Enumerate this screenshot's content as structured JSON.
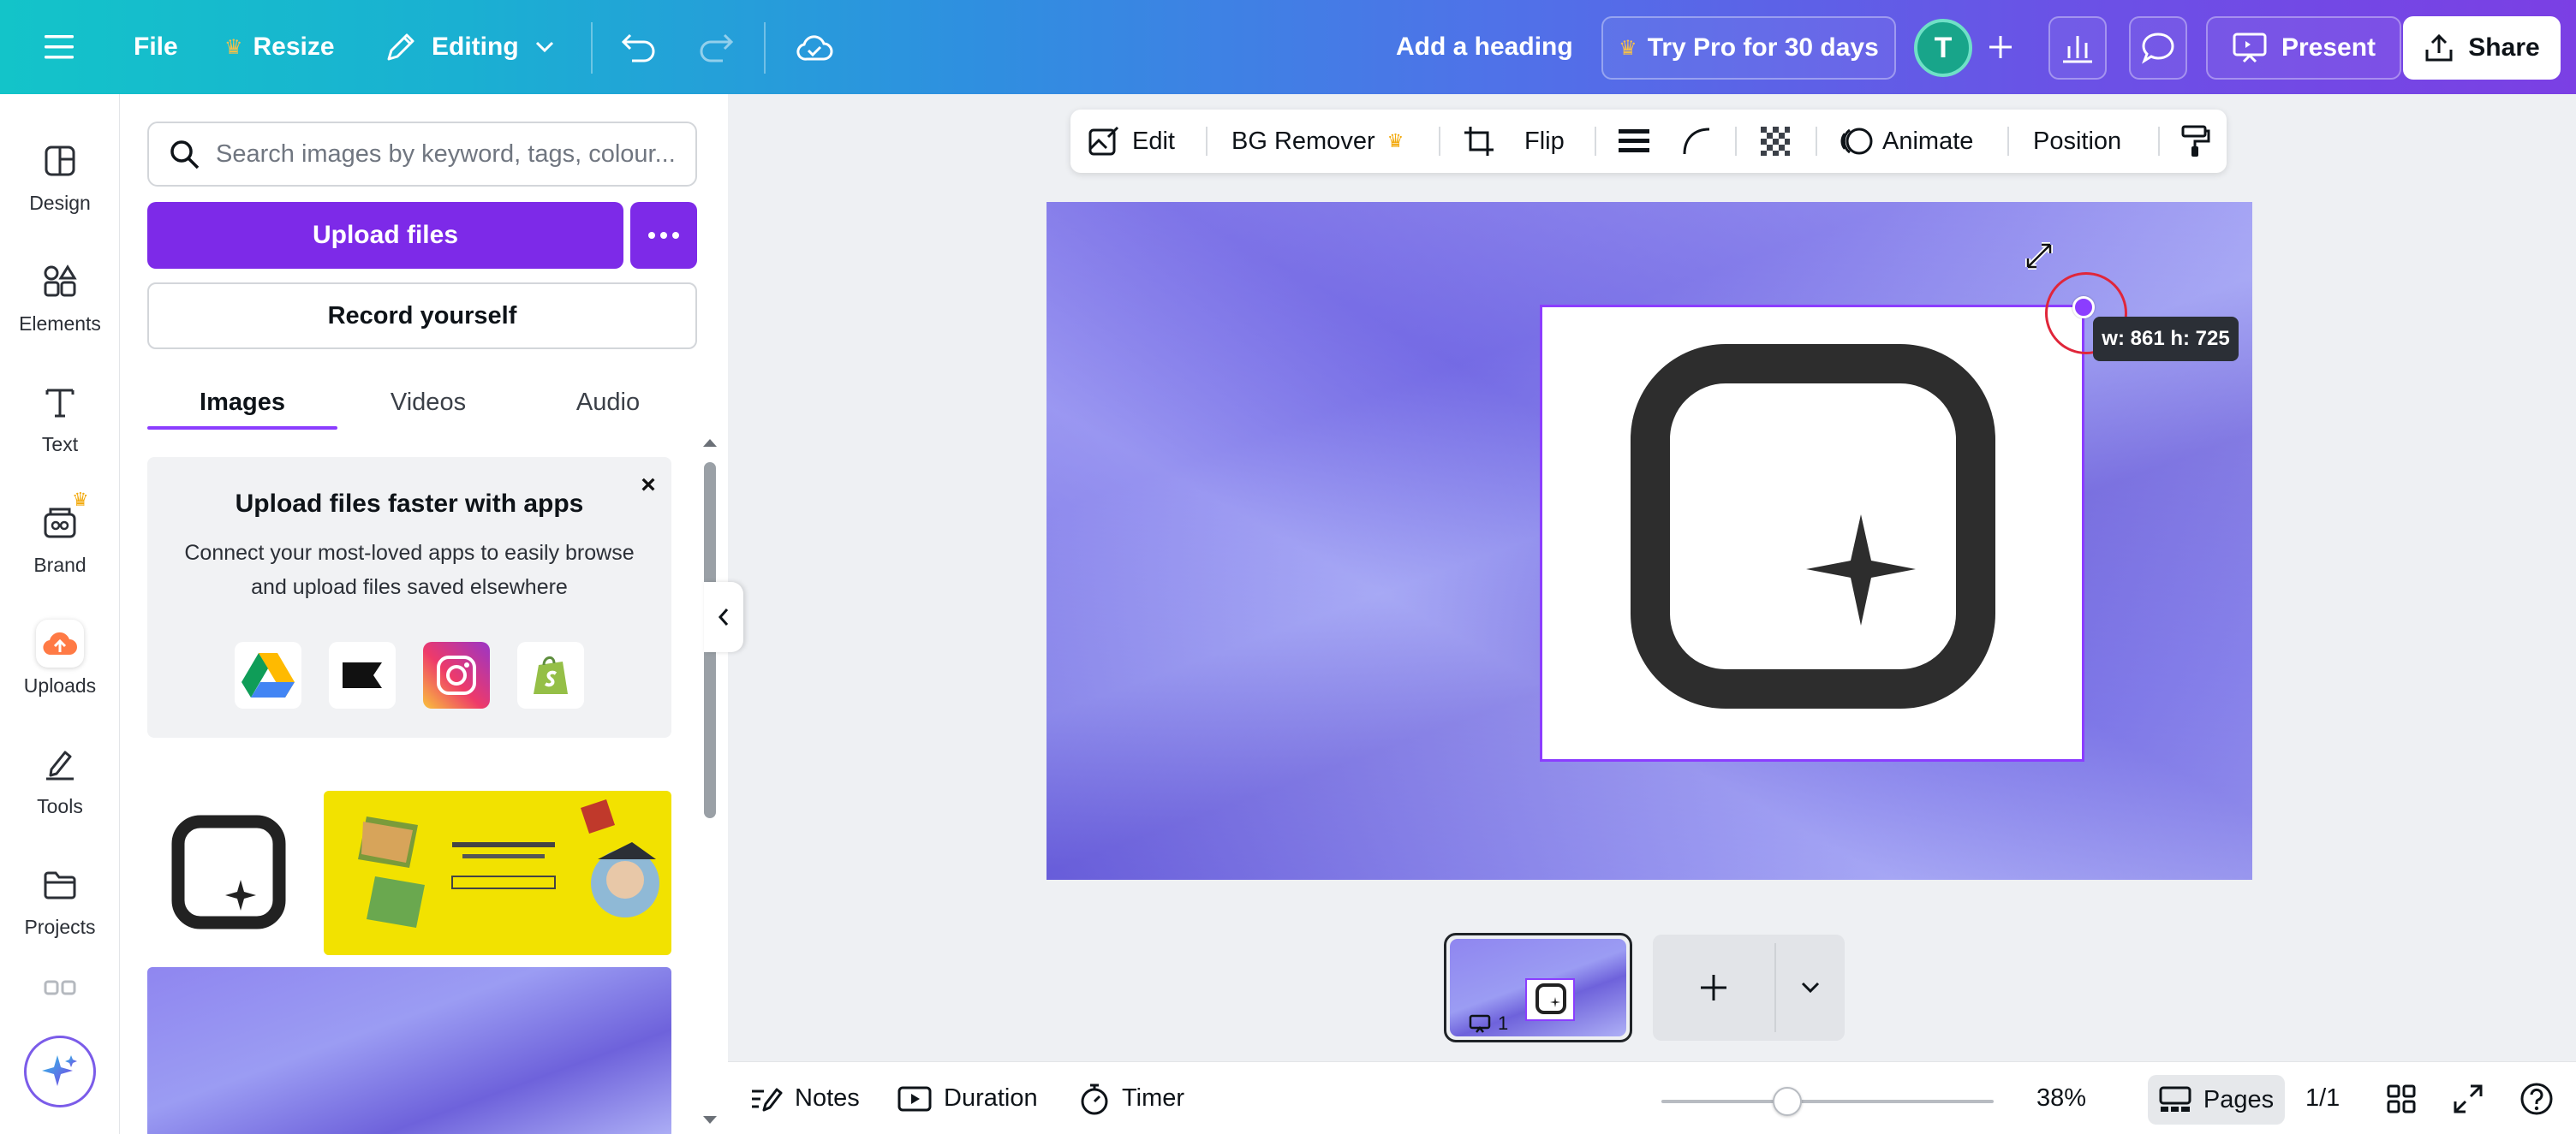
{
  "topbar": {
    "file_label": "File",
    "resize_label": "Resize",
    "editing_label": "Editing",
    "design_title": "Add a heading",
    "try_pro_label": "Try Pro for 30 days",
    "avatar_initial": "T",
    "present_label": "Present",
    "share_label": "Share"
  },
  "rail": {
    "items": [
      {
        "label": "Design"
      },
      {
        "label": "Elements"
      },
      {
        "label": "Text"
      },
      {
        "label": "Brand"
      },
      {
        "label": "Uploads"
      },
      {
        "label": "Tools"
      },
      {
        "label": "Projects"
      }
    ]
  },
  "panel": {
    "search_placeholder": "Search images by keyword, tags, colour...",
    "upload_label": "Upload files",
    "record_label": "Record yourself",
    "tabs": [
      {
        "label": "Images"
      },
      {
        "label": "Videos"
      },
      {
        "label": "Audio"
      }
    ],
    "promo": {
      "title": "Upload files faster with apps",
      "body": "Connect your most-loved apps to easily browse and upload files saved elsewhere",
      "close": "×",
      "apps": [
        "google-drive-icon",
        "klaviyo-icon",
        "instagram-icon",
        "shopify-icon"
      ]
    }
  },
  "context_toolbar": {
    "edit_label": "Edit",
    "bg_remover_label": "BG Remover",
    "flip_label": "Flip",
    "animate_label": "Animate",
    "position_label": "Position"
  },
  "canvas": {
    "dimension_readout": "w: 861 h: 725"
  },
  "page_strip": {
    "page_number": "1"
  },
  "bottombar": {
    "notes_label": "Notes",
    "duration_label": "Duration",
    "timer_label": "Timer",
    "zoom_percent": "38%",
    "zoom_fraction": 0.38,
    "pages_label": "Pages",
    "page_count": "1/1"
  },
  "colors": {
    "brand_purple": "#7d2ae8",
    "selection": "#8b3dff",
    "cursor_ring": "#e0263a",
    "avatar": "#18a58a"
  }
}
